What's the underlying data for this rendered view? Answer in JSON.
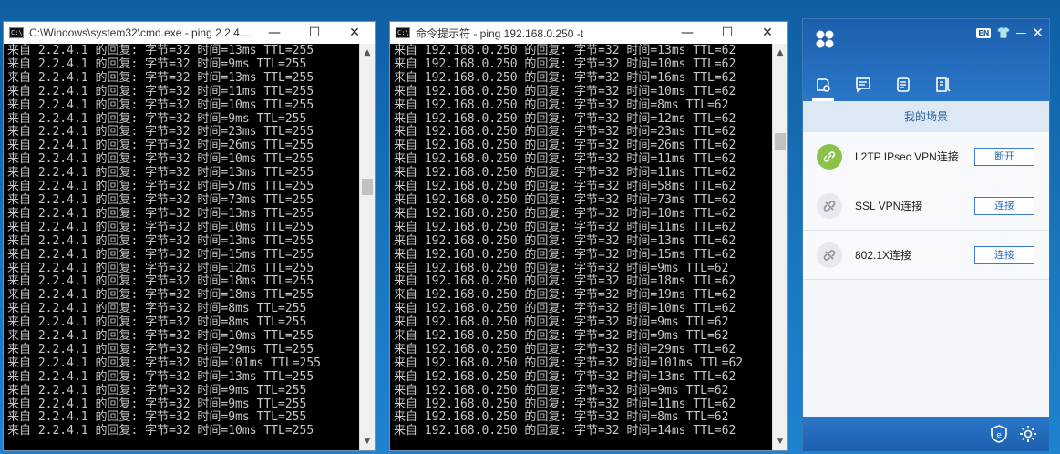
{
  "window1": {
    "title": "C:\\Windows\\system32\\cmd.exe - ping  2.2.4....",
    "minimize": "—",
    "maximize": "☐",
    "close": "✕",
    "lines": [
      "来自 2.2.4.1 的回复: 字节=32 时间=13ms TTL=255",
      "来自 2.2.4.1 的回复: 字节=32 时间=9ms TTL=255",
      "来自 2.2.4.1 的回复: 字节=32 时间=13ms TTL=255",
      "来自 2.2.4.1 的回复: 字节=32 时间=11ms TTL=255",
      "来自 2.2.4.1 的回复: 字节=32 时间=10ms TTL=255",
      "来自 2.2.4.1 的回复: 字节=32 时间=9ms TTL=255",
      "来自 2.2.4.1 的回复: 字节=32 时间=23ms TTL=255",
      "来自 2.2.4.1 的回复: 字节=32 时间=26ms TTL=255",
      "来自 2.2.4.1 的回复: 字节=32 时间=10ms TTL=255",
      "来自 2.2.4.1 的回复: 字节=32 时间=13ms TTL=255",
      "来自 2.2.4.1 的回复: 字节=32 时间=57ms TTL=255",
      "来自 2.2.4.1 的回复: 字节=32 时间=73ms TTL=255",
      "来自 2.2.4.1 的回复: 字节=32 时间=13ms TTL=255",
      "来自 2.2.4.1 的回复: 字节=32 时间=10ms TTL=255",
      "来自 2.2.4.1 的回复: 字节=32 时间=13ms TTL=255",
      "来自 2.2.4.1 的回复: 字节=32 时间=15ms TTL=255",
      "来自 2.2.4.1 的回复: 字节=32 时间=12ms TTL=255",
      "来自 2.2.4.1 的回复: 字节=32 时间=18ms TTL=255",
      "来自 2.2.4.1 的回复: 字节=32 时间=18ms TTL=255",
      "来自 2.2.4.1 的回复: 字节=32 时间=8ms TTL=255",
      "来自 2.2.4.1 的回复: 字节=32 时间=8ms TTL=255",
      "来自 2.2.4.1 的回复: 字节=32 时间=10ms TTL=255",
      "来自 2.2.4.1 的回复: 字节=32 时间=29ms TTL=255",
      "来自 2.2.4.1 的回复: 字节=32 时间=101ms TTL=255",
      "来自 2.2.4.1 的回复: 字节=32 时间=13ms TTL=255",
      "来自 2.2.4.1 的回复: 字节=32 时间=9ms TTL=255",
      "来自 2.2.4.1 的回复: 字节=32 时间=9ms TTL=255",
      "来自 2.2.4.1 的回复: 字节=32 时间=9ms TTL=255",
      "来自 2.2.4.1 的回复: 字节=32 时间=10ms TTL=255"
    ]
  },
  "window2": {
    "title": "命令提示符 - ping  192.168.0.250 -t",
    "minimize": "—",
    "maximize": "☐",
    "close": "✕",
    "lines": [
      "来自 192.168.0.250 的回复: 字节=32 时间=13ms TTL=62",
      "来自 192.168.0.250 的回复: 字节=32 时间=10ms TTL=62",
      "来自 192.168.0.250 的回复: 字节=32 时间=16ms TTL=62",
      "来自 192.168.0.250 的回复: 字节=32 时间=10ms TTL=62",
      "来自 192.168.0.250 的回复: 字节=32 时间=8ms TTL=62",
      "来自 192.168.0.250 的回复: 字节=32 时间=12ms TTL=62",
      "来自 192.168.0.250 的回复: 字节=32 时间=23ms TTL=62",
      "来自 192.168.0.250 的回复: 字节=32 时间=26ms TTL=62",
      "来自 192.168.0.250 的回复: 字节=32 时间=11ms TTL=62",
      "来自 192.168.0.250 的回复: 字节=32 时间=11ms TTL=62",
      "来自 192.168.0.250 的回复: 字节=32 时间=58ms TTL=62",
      "来自 192.168.0.250 的回复: 字节=32 时间=73ms TTL=62",
      "来自 192.168.0.250 的回复: 字节=32 时间=10ms TTL=62",
      "来自 192.168.0.250 的回复: 字节=32 时间=11ms TTL=62",
      "来自 192.168.0.250 的回复: 字节=32 时间=13ms TTL=62",
      "来自 192.168.0.250 的回复: 字节=32 时间=15ms TTL=62",
      "来自 192.168.0.250 的回复: 字节=32 时间=9ms TTL=62",
      "来自 192.168.0.250 的回复: 字节=32 时间=18ms TTL=62",
      "来自 192.168.0.250 的回复: 字节=32 时间=19ms TTL=62",
      "来自 192.168.0.250 的回复: 字节=32 时间=10ms TTL=62",
      "来自 192.168.0.250 的回复: 字节=32 时间=9ms TTL=62",
      "来自 192.168.0.250 的回复: 字节=32 时间=9ms TTL=62",
      "来自 192.168.0.250 的回复: 字节=32 时间=29ms TTL=62",
      "来自 192.168.0.250 的回复: 字节=32 时间=101ms TTL=62",
      "来自 192.168.0.250 的回复: 字节=32 时间=13ms TTL=62",
      "来自 192.168.0.250 的回复: 字节=32 时间=9ms TTL=62",
      "来自 192.168.0.250 的回复: 字节=32 时间=11ms TTL=62",
      "来自 192.168.0.250 的回复: 字节=32 时间=8ms TTL=62",
      "来自 192.168.0.250 的回复: 字节=32 时间=14ms TTL=62"
    ]
  },
  "vpn_client": {
    "lang_badge": "EN",
    "section_title": "我的场景",
    "tabs": [
      "scene-tab-icon",
      "message-tab-icon",
      "log-tab-icon",
      "notes-tab-icon"
    ],
    "items": [
      {
        "label": "L2TP IPsec VPN连接",
        "action": "断开",
        "connected": true
      },
      {
        "label": "SSL VPN连接",
        "action": "连接",
        "connected": false
      },
      {
        "label": "802.1X连接",
        "action": "连接",
        "connected": false
      }
    ],
    "colors": {
      "header": "#1d5fae",
      "connected": "#8bc34a",
      "disconnected": "#e6e9ee"
    }
  }
}
